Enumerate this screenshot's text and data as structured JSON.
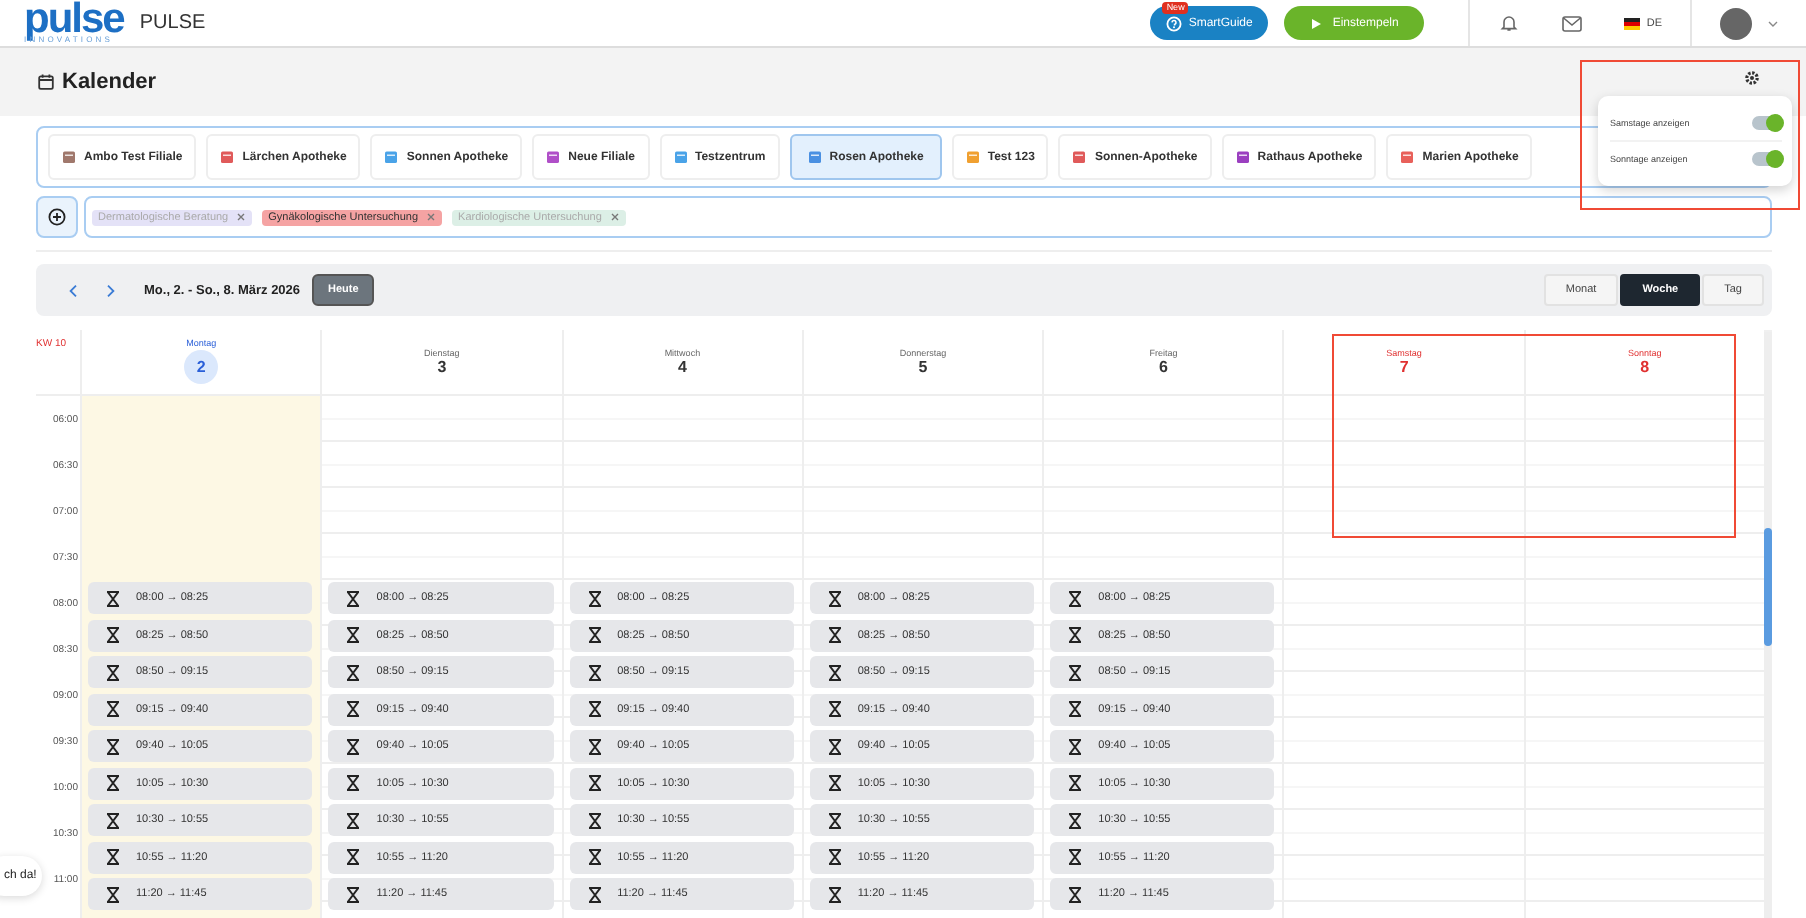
{
  "header": {
    "logo": "pulse",
    "logo_sub": "INNOVATIONS",
    "app_name": "PULSE",
    "smartguide": {
      "label": "SmartGuide",
      "badge": "New"
    },
    "clock_in": "Einstempeln",
    "language": "DE"
  },
  "page": {
    "title": "Kalender"
  },
  "locations": [
    {
      "label": "Ambo Test Filiale",
      "color": "#a0786c",
      "selected": false
    },
    {
      "label": "Lärchen Apotheke",
      "color": "#e05a5a",
      "selected": false
    },
    {
      "label": "Sonnen Apotheke",
      "color": "#4aa3e8",
      "selected": false
    },
    {
      "label": "Neue Filiale",
      "color": "#b04fc8",
      "selected": false
    },
    {
      "label": "Testzentrum",
      "color": "#4aa3e8",
      "selected": false
    },
    {
      "label": "Rosen Apotheke",
      "color": "#4a90e2",
      "selected": true
    },
    {
      "label": "Test 123",
      "color": "#f0a030",
      "selected": false
    },
    {
      "label": "Sonnen-Apotheke",
      "color": "#e05a5a",
      "selected": false
    },
    {
      "label": "Rathaus Apotheke",
      "color": "#9b3fc0",
      "selected": false
    },
    {
      "label": "Marien Apotheke",
      "color": "#e8605a",
      "selected": false
    }
  ],
  "tags": [
    {
      "label": "Dermatologische Beratung",
      "color": "#e4e2f7",
      "active": false
    },
    {
      "label": "Gynäkologische Untersuchung",
      "color": "#f5a3a3",
      "active": true
    },
    {
      "label": "Kardiologische Untersuchung",
      "color": "#dcefe6",
      "active": false
    }
  ],
  "toolbar": {
    "range": "Mo., 2. - So., 8. März 2026",
    "today": "Heute",
    "views": [
      {
        "label": "Monat",
        "selected": false
      },
      {
        "label": "Woche",
        "selected": true
      },
      {
        "label": "Tag",
        "selected": false
      }
    ]
  },
  "calendar": {
    "week": "KW 10",
    "times": [
      "06:00",
      "06:30",
      "07:00",
      "07:30",
      "08:00",
      "08:30",
      "09:00",
      "09:30",
      "10:00",
      "10:30",
      "11:00"
    ],
    "days": [
      {
        "name": "Montag",
        "date": "2",
        "today": true,
        "weekend": false,
        "appointments": [
          "08:00 → 08:25",
          "08:25 → 08:50",
          "08:50 → 09:15",
          "09:15 → 09:40",
          "09:40 → 10:05",
          "10:05 → 10:30",
          "10:30 → 10:55",
          "10:55 → 11:20",
          "11:20 → 11:45"
        ]
      },
      {
        "name": "Dienstag",
        "date": "3",
        "today": false,
        "weekend": false,
        "appointments": [
          "08:00 → 08:25",
          "08:25 → 08:50",
          "08:50 → 09:15",
          "09:15 → 09:40",
          "09:40 → 10:05",
          "10:05 → 10:30",
          "10:30 → 10:55",
          "10:55 → 11:20",
          "11:20 → 11:45"
        ]
      },
      {
        "name": "Mittwoch",
        "date": "4",
        "today": false,
        "weekend": false,
        "appointments": [
          "08:00 → 08:25",
          "08:25 → 08:50",
          "08:50 → 09:15",
          "09:15 → 09:40",
          "09:40 → 10:05",
          "10:05 → 10:30",
          "10:30 → 10:55",
          "10:55 → 11:20",
          "11:20 → 11:45"
        ]
      },
      {
        "name": "Donnerstag",
        "date": "5",
        "today": false,
        "weekend": false,
        "appointments": [
          "08:00 → 08:25",
          "08:25 → 08:50",
          "08:50 → 09:15",
          "09:15 → 09:40",
          "09:40 → 10:05",
          "10:05 → 10:30",
          "10:30 → 10:55",
          "10:55 → 11:20",
          "11:20 → 11:45"
        ]
      },
      {
        "name": "Freitag",
        "date": "6",
        "today": false,
        "weekend": false,
        "appointments": [
          "08:00 → 08:25",
          "08:25 → 08:50",
          "08:50 → 09:15",
          "09:15 → 09:40",
          "09:40 → 10:05",
          "10:05 → 10:30",
          "10:30 → 10:55",
          "10:55 → 11:20",
          "11:20 → 11:45"
        ]
      },
      {
        "name": "Samstag",
        "date": "7",
        "today": false,
        "weekend": true
      },
      {
        "name": "Sonntag",
        "date": "8",
        "today": false,
        "weekend": true
      }
    ]
  },
  "settings_popover": {
    "toggles": [
      {
        "label": "Samstage anzeigen",
        "on": true
      },
      {
        "label": "Sonntage anzeigen",
        "on": true
      }
    ]
  },
  "chat_bubble": {
    "text": "ch da!"
  }
}
